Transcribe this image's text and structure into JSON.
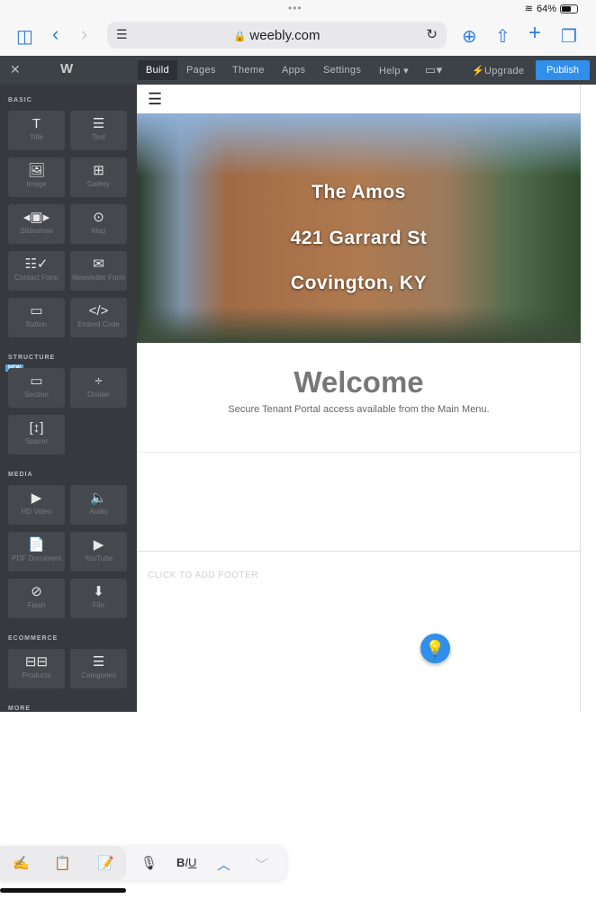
{
  "status": {
    "battery": "64%"
  },
  "browser": {
    "url": "weebly.com"
  },
  "toolbar": {
    "tabs": [
      "Build",
      "Pages",
      "Theme",
      "Apps",
      "Settings",
      "Help ▾"
    ],
    "upgrade": "Upgrade",
    "publish": "Publish"
  },
  "sidebar": {
    "sections": [
      {
        "title": "BASIC",
        "items": [
          {
            "icon": "T",
            "label": "Title"
          },
          {
            "icon": "☰",
            "label": "Text"
          },
          {
            "icon": "🖼",
            "label": "Image"
          },
          {
            "icon": "⊞",
            "label": "Gallery"
          },
          {
            "icon": "◂▣▸",
            "label": "Slideshow"
          },
          {
            "icon": "⊙",
            "label": "Map"
          },
          {
            "icon": "☷✓",
            "label": "Contact Form"
          },
          {
            "icon": "✉",
            "label": "Newsletter Form"
          },
          {
            "icon": "▭",
            "label": "Button"
          },
          {
            "icon": "</>",
            "label": "Embed Code"
          }
        ]
      },
      {
        "title": "STRUCTURE",
        "items": [
          {
            "icon": "▭",
            "label": "Section"
          },
          {
            "icon": "÷",
            "label": "Divider"
          },
          {
            "icon": "[↕]",
            "label": "Spacer"
          }
        ]
      },
      {
        "title": "MEDIA",
        "items": [
          {
            "icon": "▶",
            "label": "HD Video"
          },
          {
            "icon": "🔈",
            "label": "Audio"
          },
          {
            "icon": "📄",
            "label": "PDF Document"
          },
          {
            "icon": "▶",
            "label": "YouTube"
          },
          {
            "icon": "⊘",
            "label": "Flash"
          },
          {
            "icon": "⬇",
            "label": "File"
          }
        ]
      },
      {
        "title": "ECOMMERCE",
        "items": [
          {
            "icon": "⊟⊟",
            "label": "Products"
          },
          {
            "icon": "☰",
            "label": "Categories"
          }
        ]
      },
      {
        "title": "MORE",
        "items": [
          {
            "icon": "⊙",
            "label": ""
          },
          {
            "icon": "▣",
            "label": ""
          }
        ]
      }
    ],
    "new_badge": "NEW"
  },
  "site": {
    "hero_lines": [
      "The Amos",
      "421 Garrard St",
      "Covington, KY"
    ],
    "welcome": "Welcome",
    "subtitle": "Secure Tenant Portal access available from the Main Menu.",
    "footer": "CLICK TO ADD FOOTER"
  },
  "colors": {
    "accent": "#2f8fea",
    "sidebar": "#363a3e",
    "toolbar": "#3d4247"
  }
}
